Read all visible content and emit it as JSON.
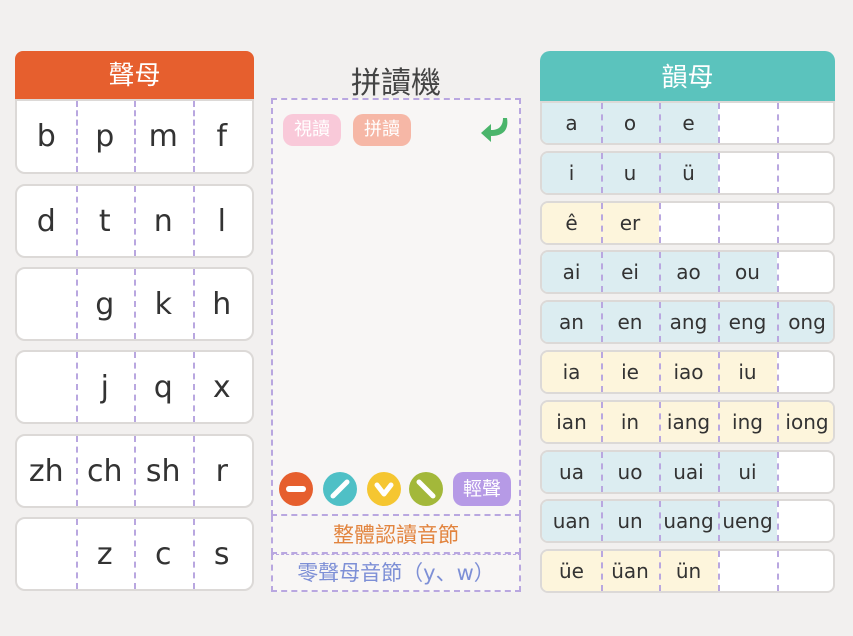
{
  "initials": {
    "header": "聲母",
    "rows": [
      [
        "b",
        "p",
        "m",
        "f"
      ],
      [
        "d",
        "t",
        "n",
        "l"
      ],
      [
        "",
        "g",
        "k",
        "h"
      ],
      [
        "",
        "j",
        "q",
        "x"
      ],
      [
        "zh",
        "ch",
        "sh",
        "r"
      ],
      [
        "",
        "z",
        "c",
        "s"
      ]
    ]
  },
  "machine": {
    "title": "拼讀機",
    "view_read": "視讀",
    "spell_read": "拼讀",
    "neutral_tone": "輕聲",
    "whole_syllables": "整體認讀音節",
    "zero_initial": "零聲母音節（y、w）"
  },
  "finals": {
    "header": "韻母",
    "rows": [
      {
        "cells": [
          "a",
          "o",
          "e",
          "",
          ""
        ],
        "color": "blue"
      },
      {
        "cells": [
          "i",
          "u",
          "ü",
          "",
          ""
        ],
        "color": "blue"
      },
      {
        "cells": [
          "ê",
          "er",
          "",
          "",
          ""
        ],
        "color": "yellow"
      },
      {
        "cells": [
          "ai",
          "ei",
          "ao",
          "ou",
          ""
        ],
        "color": "blue"
      },
      {
        "cells": [
          "an",
          "en",
          "ang",
          "eng",
          "ong"
        ],
        "color": "blue"
      },
      {
        "cells": [
          "ia",
          "ie",
          "iao",
          "iu",
          ""
        ],
        "color": "yellow"
      },
      {
        "cells": [
          "ian",
          "in",
          "iang",
          "ing",
          "iong"
        ],
        "color": "yellow"
      },
      {
        "cells": [
          "ua",
          "uo",
          "uai",
          "ui",
          ""
        ],
        "color": "blue"
      },
      {
        "cells": [
          "uan",
          "un",
          "uang",
          "ueng",
          ""
        ],
        "color": "blue"
      },
      {
        "cells": [
          "üe",
          "üan",
          "ün",
          "",
          ""
        ],
        "color": "yellow"
      }
    ]
  },
  "colors": {
    "blue": "#dcedf1",
    "yellow": "#fdf5dc",
    "orange": "#e65f2e",
    "teal": "#5bc3bd"
  }
}
